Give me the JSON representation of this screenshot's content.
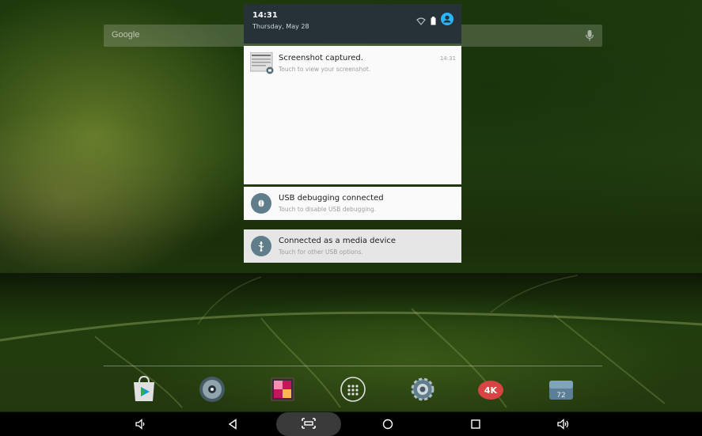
{
  "search": {
    "label": "Google",
    "icon": "mic-icon"
  },
  "shade": {
    "time": "14:31",
    "date": "Thursday, May 28",
    "status_icons": [
      "wifi-icon",
      "battery-icon",
      "account-icon"
    ],
    "accent": "#29b6f6"
  },
  "notifications": [
    {
      "title": "Screenshot captured.",
      "subtitle": "Touch to view your screenshot.",
      "time": "14:31",
      "icon": "screenshot-thumbnail"
    },
    {
      "title": "USB debugging connected",
      "subtitle": "Touch to disable USB debugging.",
      "icon": "bug-icon"
    },
    {
      "title": "Connected as a media device",
      "subtitle": "Touch for other USB options.",
      "icon": "usb-icon"
    }
  ],
  "dock": [
    {
      "name": "Play Store",
      "icon": "play-store-icon"
    },
    {
      "name": "Music",
      "icon": "music-disc-icon"
    },
    {
      "name": "Gallery",
      "icon": "gallery-icon"
    },
    {
      "name": "All apps",
      "icon": "app-drawer-icon"
    },
    {
      "name": "Settings",
      "icon": "settings-gear-icon"
    },
    {
      "name": "4K Player",
      "icon": "4k-player-icon",
      "label": "4K"
    },
    {
      "name": "Weather",
      "icon": "weather-icon"
    }
  ],
  "navbar": {
    "buttons": [
      "volume-down-icon",
      "back-icon",
      "screenshot-icon",
      "home-icon",
      "recents-icon",
      "volume-up-icon"
    ]
  }
}
